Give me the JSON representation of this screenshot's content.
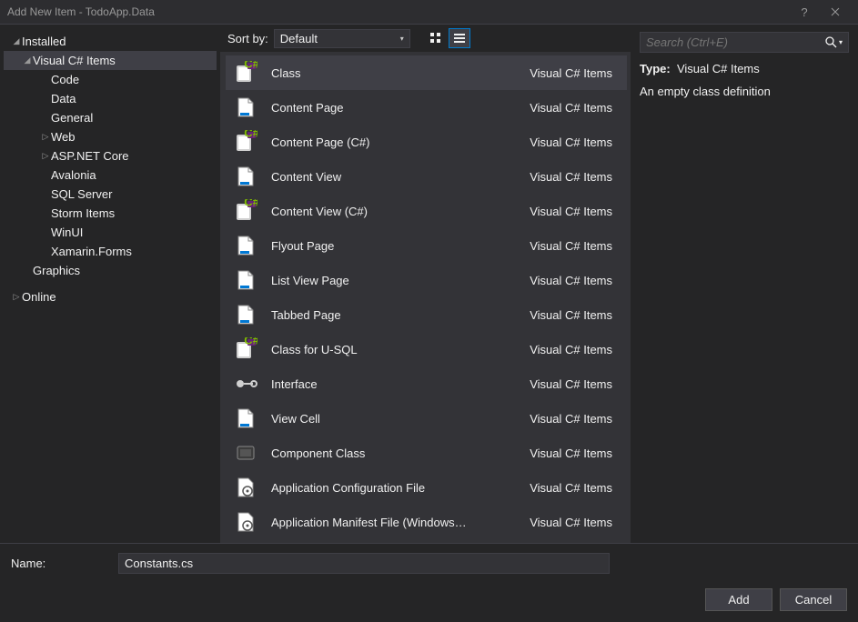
{
  "window_title": "Add New Item - TodoApp.Data",
  "tree": {
    "installed": {
      "label": "Installed",
      "expanded": true
    },
    "vcsharp": {
      "label": "Visual C# Items",
      "expanded": true,
      "selected": true
    },
    "children": [
      {
        "label": "Code",
        "expander": ""
      },
      {
        "label": "Data",
        "expander": ""
      },
      {
        "label": "General",
        "expander": ""
      },
      {
        "label": "Web",
        "expander": "▷"
      },
      {
        "label": "ASP.NET Core",
        "expander": "▷"
      },
      {
        "label": "Avalonia",
        "expander": ""
      },
      {
        "label": "SQL Server",
        "expander": ""
      },
      {
        "label": "Storm Items",
        "expander": ""
      },
      {
        "label": "WinUI",
        "expander": ""
      },
      {
        "label": "Xamarin.Forms",
        "expander": ""
      }
    ],
    "graphics": {
      "label": "Graphics"
    },
    "online": {
      "label": "Online",
      "expanded": false
    }
  },
  "sort": {
    "label": "Sort by:",
    "value": "Default"
  },
  "items": [
    {
      "label": "Class",
      "category": "Visual C# Items",
      "selected": true,
      "icon": "class"
    },
    {
      "label": "Content Page",
      "category": "Visual C# Items",
      "icon": "page"
    },
    {
      "label": "Content Page (C#)",
      "category": "Visual C# Items",
      "icon": "class"
    },
    {
      "label": "Content View",
      "category": "Visual C# Items",
      "icon": "page"
    },
    {
      "label": "Content View (C#)",
      "category": "Visual C# Items",
      "icon": "class"
    },
    {
      "label": "Flyout Page",
      "category": "Visual C# Items",
      "icon": "page"
    },
    {
      "label": "List View Page",
      "category": "Visual C# Items",
      "icon": "page"
    },
    {
      "label": "Tabbed Page",
      "category": "Visual C# Items",
      "icon": "page"
    },
    {
      "label": "Class for U-SQL",
      "category": "Visual C# Items",
      "icon": "class"
    },
    {
      "label": "Interface",
      "category": "Visual C# Items",
      "icon": "interface"
    },
    {
      "label": "View Cell",
      "category": "Visual C# Items",
      "icon": "page"
    },
    {
      "label": "Component Class",
      "category": "Visual C# Items",
      "icon": "component"
    },
    {
      "label": "Application Configuration File",
      "category": "Visual C# Items",
      "icon": "config"
    },
    {
      "label": "Application Manifest File (Windows…",
      "category": "Visual C# Items",
      "icon": "config"
    }
  ],
  "search": {
    "placeholder": "Search (Ctrl+E)"
  },
  "info": {
    "type_label": "Type:",
    "type_value": "Visual C# Items",
    "description": "An empty class definition"
  },
  "name_field": {
    "label": "Name:",
    "value": "Constants.cs"
  },
  "buttons": {
    "add": "Add",
    "cancel": "Cancel"
  }
}
